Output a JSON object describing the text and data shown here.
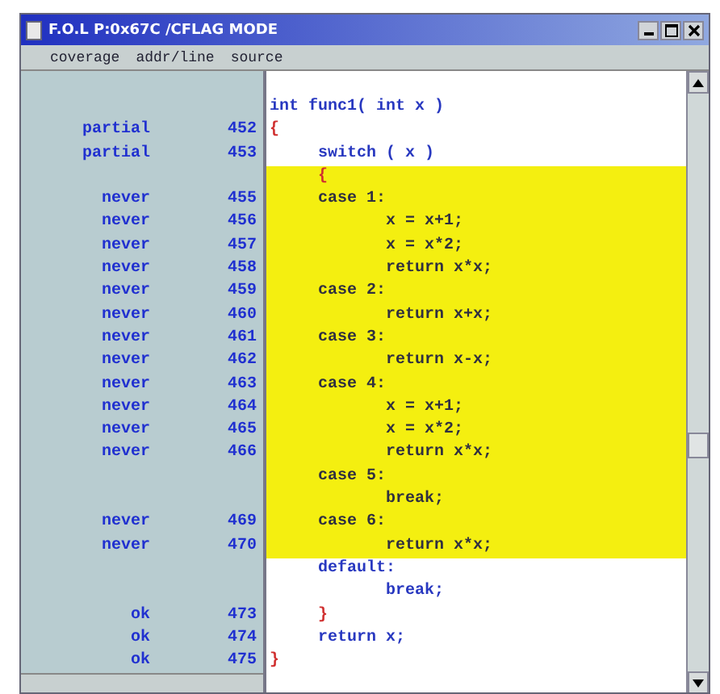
{
  "window": {
    "title": "F.O.L P:0x67C /CFLAG MODE"
  },
  "columns": [
    "coverage",
    "addr/line",
    "source"
  ],
  "rows": [
    {
      "code": "int func1( int x )",
      "highlighted": false,
      "kind": "code"
    },
    {
      "coverage": "partial",
      "line": "452",
      "code": "{",
      "highlighted": false,
      "kind": "brace"
    },
    {
      "coverage": "partial",
      "line": "453",
      "code": "     switch ( x )",
      "highlighted": false,
      "kind": "code"
    },
    {
      "code": "     {",
      "highlighted": true,
      "kind": "brace"
    },
    {
      "coverage": "never",
      "line": "455",
      "code": "     case 1:",
      "highlighted": true,
      "kind": "code"
    },
    {
      "coverage": "never",
      "line": "456",
      "code": "            x = x+1;",
      "highlighted": true,
      "kind": "code"
    },
    {
      "coverage": "never",
      "line": "457",
      "code": "            x = x*2;",
      "highlighted": true,
      "kind": "code"
    },
    {
      "coverage": "never",
      "line": "458",
      "code": "            return x*x;",
      "highlighted": true,
      "kind": "code"
    },
    {
      "coverage": "never",
      "line": "459",
      "code": "     case 2:",
      "highlighted": true,
      "kind": "code"
    },
    {
      "coverage": "never",
      "line": "460",
      "code": "            return x+x;",
      "highlighted": true,
      "kind": "code"
    },
    {
      "coverage": "never",
      "line": "461",
      "code": "     case 3:",
      "highlighted": true,
      "kind": "code"
    },
    {
      "coverage": "never",
      "line": "462",
      "code": "            return x-x;",
      "highlighted": true,
      "kind": "code"
    },
    {
      "coverage": "never",
      "line": "463",
      "code": "     case 4:",
      "highlighted": true,
      "kind": "code"
    },
    {
      "coverage": "never",
      "line": "464",
      "code": "            x = x+1;",
      "highlighted": true,
      "kind": "code"
    },
    {
      "coverage": "never",
      "line": "465",
      "code": "            x = x*2;",
      "highlighted": true,
      "kind": "code"
    },
    {
      "coverage": "never",
      "line": "466",
      "code": "            return x*x;",
      "highlighted": true,
      "kind": "code"
    },
    {
      "code": "     case 5:",
      "highlighted": true,
      "kind": "code"
    },
    {
      "code": "            break;",
      "highlighted": true,
      "kind": "code"
    },
    {
      "coverage": "never",
      "line": "469",
      "code": "     case 6:",
      "highlighted": true,
      "kind": "code"
    },
    {
      "coverage": "never",
      "line": "470",
      "code": "            return x*x;",
      "highlighted": true,
      "kind": "code"
    },
    {
      "code": "     default:",
      "highlighted": false,
      "kind": "code"
    },
    {
      "code": "            break;",
      "highlighted": false,
      "kind": "code"
    },
    {
      "coverage": "ok",
      "line": "473",
      "code": "     }",
      "highlighted": false,
      "kind": "brace"
    },
    {
      "coverage": "ok",
      "line": "474",
      "code": "     return x;",
      "highlighted": false,
      "kind": "code"
    },
    {
      "coverage": "ok",
      "line": "475",
      "code": "}",
      "highlighted": false,
      "kind": "brace"
    }
  ]
}
